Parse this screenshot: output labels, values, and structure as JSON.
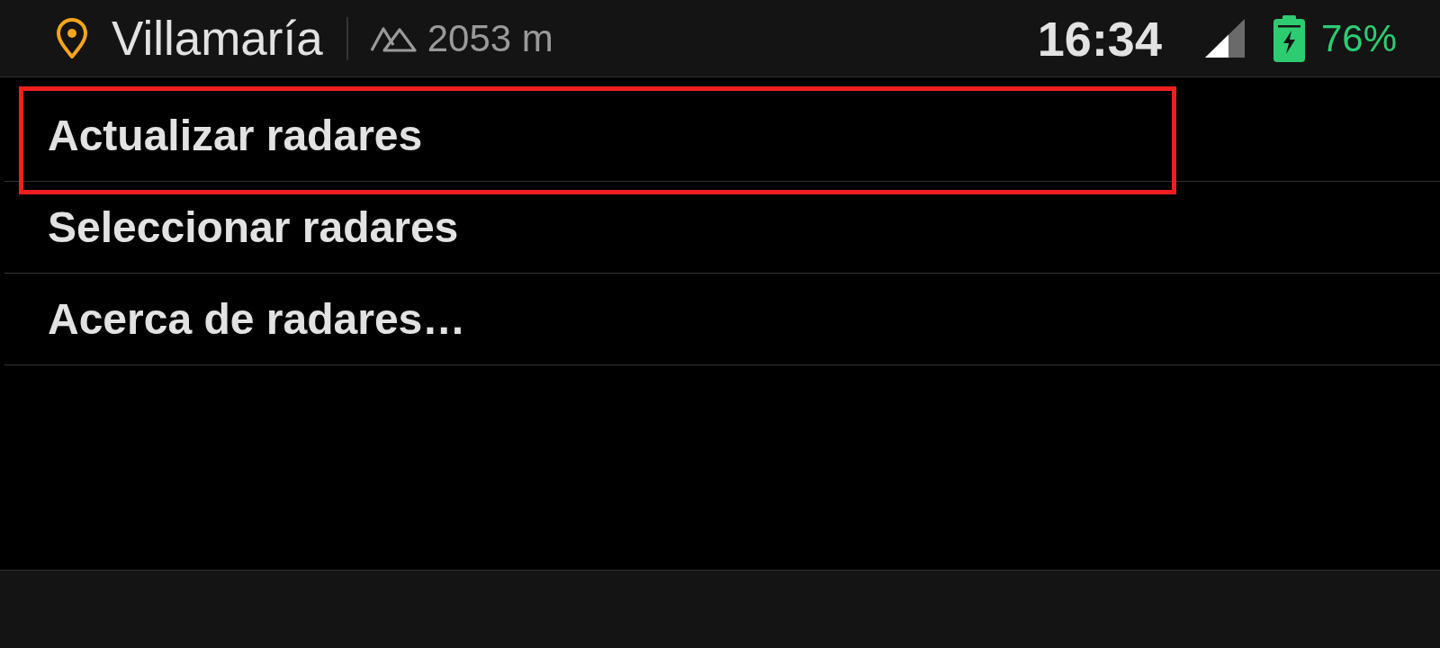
{
  "status_bar": {
    "location": "Villamaría",
    "altitude": "2053 m",
    "time": "16:34",
    "battery": "76%",
    "charging": true
  },
  "menu": {
    "items": [
      {
        "label": "Actualizar radares",
        "highlighted": true
      },
      {
        "label": "Seleccionar radares",
        "highlighted": false
      },
      {
        "label": "Acerca de radares…",
        "highlighted": false
      }
    ]
  }
}
